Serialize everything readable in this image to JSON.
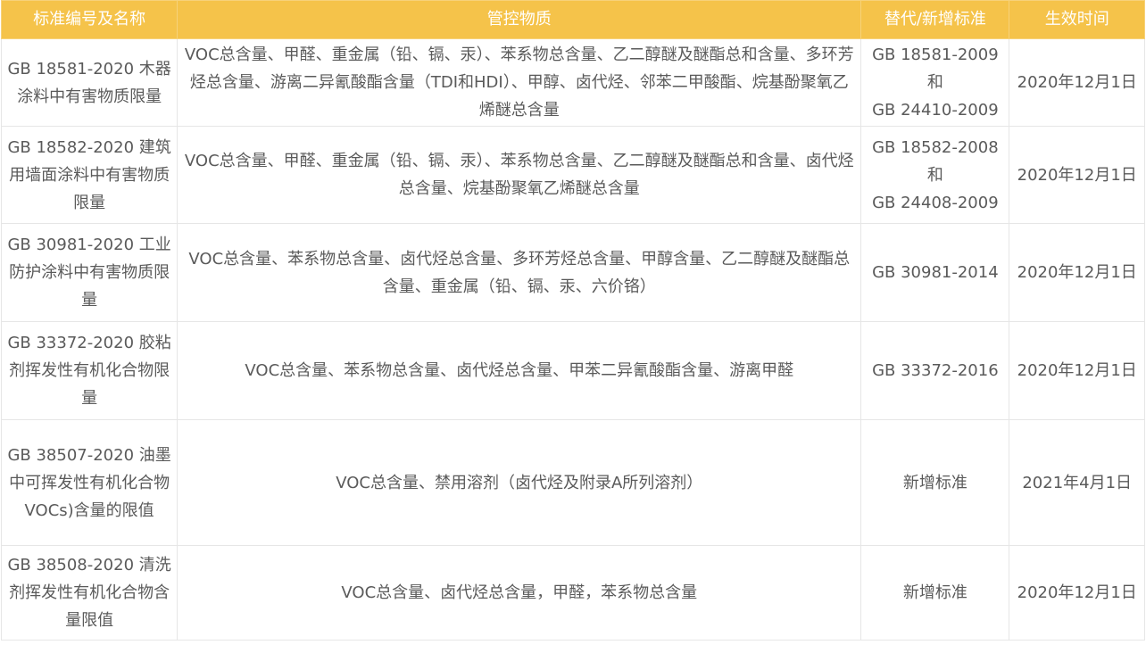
{
  "table": {
    "headers": {
      "name": "标准编号及名称",
      "substances": "管控物质",
      "replaces": "替代/新增标准",
      "effective": "生效时间"
    },
    "rows": [
      {
        "name": "GB 18581-2020 木器涂料中有害物质限量",
        "substances": "VOC总含量、甲醛、重金属（铅、镉、汞）、苯系物总含量、乙二醇醚及醚酯总和含量、多环芳烃总含量、游离二异氰酸酯含量（TDI和HDI）、甲醇、卤代烃、邻苯二甲酸酯、烷基酚聚氧乙烯醚总含量",
        "replaces": [
          "GB 18581-2009",
          "和",
          "GB 24410-2009"
        ],
        "effective": "2020年12月1日"
      },
      {
        "name": "GB 18582-2020 建筑用墙面涂料中有害物质限量",
        "substances": "VOC总含量、甲醛、重金属（铅、镉、汞）、苯系物总含量、乙二醇醚及醚酯总和含量、卤代烃总含量、烷基酚聚氧乙烯醚总含量",
        "replaces": [
          "GB 18582-2008",
          "和",
          "GB 24408-2009"
        ],
        "effective": "2020年12月1日"
      },
      {
        "name": "GB 30981-2020 工业防护涂料中有害物质限量",
        "substances": "VOC总含量、苯系物总含量、卤代烃总含量、多环芳烃总含量、甲醇含量、乙二醇醚及醚酯总含量、重金属（铅、镉、汞、六价铬）",
        "replaces": [
          "GB 30981-2014"
        ],
        "effective": "2020年12月1日"
      },
      {
        "name": "GB 33372-2020 胶粘剂挥发性有机化合物限量",
        "substances": "VOC总含量、苯系物总含量、卤代烃总含量、甲苯二异氰酸酯含量、游离甲醛",
        "replaces": [
          "GB 33372-2016"
        ],
        "effective": "2020年12月1日"
      },
      {
        "name": "GB 38507-2020 油墨中可挥发性有机化合物 VOCs)含量的限值",
        "substances": "VOC总含量、禁用溶剂（卤代烃及附录A所列溶剂）",
        "replaces": [
          "新增标准"
        ],
        "effective": "2021年4月1日"
      },
      {
        "name": "GB 38508-2020 清洗剂挥发性有机化合物含量限值",
        "substances": "VOC总含量、卤代烃总含量，甲醛，苯系物总含量",
        "replaces": [
          "新增标准"
        ],
        "effective": "2020年12月1日"
      }
    ]
  },
  "colors": {
    "header_bg": "#f5c34a",
    "header_text": "#ffffff",
    "body_text": "#5a5a5a",
    "border": "#e6e6e6"
  }
}
